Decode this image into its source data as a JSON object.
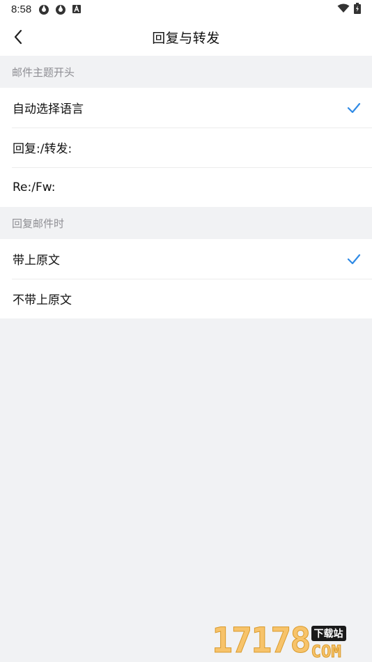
{
  "status_bar": {
    "time": "8:58",
    "left_icons": [
      "app-notification-icon",
      "app-notification-icon",
      "a-box-icon"
    ],
    "right_icons": [
      "wifi-icon",
      "battery-charging-icon"
    ]
  },
  "app_bar": {
    "back_icon": "chevron-left-icon",
    "title": "回复与转发"
  },
  "sections": [
    {
      "header": "邮件主题开头",
      "items": [
        {
          "label": "自动选择语言",
          "selected": true
        },
        {
          "label": "回复:/转发:",
          "selected": false
        },
        {
          "label": "Re:/Fw:",
          "selected": false
        }
      ]
    },
    {
      "header": "回复邮件时",
      "items": [
        {
          "label": "带上原文",
          "selected": true
        },
        {
          "label": "不带上原文",
          "selected": false
        }
      ]
    }
  ],
  "colors": {
    "accent": "#2f8ae5",
    "background": "#f1f2f4",
    "section_header_text": "#8e8e93"
  },
  "watermark": {
    "number": "17178",
    "badge": "下载站",
    "suffix": "COM"
  }
}
